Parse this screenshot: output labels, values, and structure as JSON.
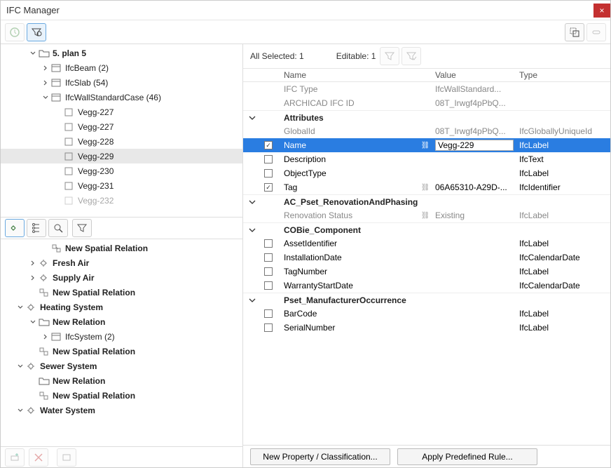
{
  "title": "IFC Manager",
  "close_label": "×",
  "selection": {
    "all_selected": "All Selected: 1",
    "editable": "Editable: 1"
  },
  "headers": {
    "name": "Name",
    "value": "Value",
    "type": "Type"
  },
  "cols": {
    "ifc_type": {
      "name": "IFC Type",
      "value": "IfcWallStandard..."
    },
    "archicad_id": {
      "name": "ARCHICAD IFC ID",
      "value": "08T_Irwgf4pPbQ..."
    }
  },
  "groups": {
    "attributes": "Attributes",
    "renov": "AC_Pset_RenovationAndPhasing",
    "cobie": "COBie_Component",
    "pset_mfr": "Pset_ManufacturerOccurrence"
  },
  "attrs": {
    "globalid": {
      "name": "GlobalId",
      "value": "08T_Irwgf4pPbQ...",
      "type": "IfcGloballyUniqueId"
    },
    "name": {
      "name": "Name",
      "value": "Vegg-229",
      "type": "IfcLabel"
    },
    "desc": {
      "name": "Description",
      "type": "IfcText"
    },
    "objtype": {
      "name": "ObjectType",
      "type": "IfcLabel"
    },
    "tag": {
      "name": "Tag",
      "value": "06A65310-A29D-...",
      "type": "IfcIdentifier"
    }
  },
  "renov": {
    "status": {
      "name": "Renovation Status",
      "value": "Existing",
      "type": "IfcLabel"
    }
  },
  "cobie": {
    "assetid": {
      "name": "AssetIdentifier",
      "type": "IfcLabel"
    },
    "instdate": {
      "name": "InstallationDate",
      "type": "IfcCalendarDate"
    },
    "tagno": {
      "name": "TagNumber",
      "type": "IfcLabel"
    },
    "warranty": {
      "name": "WarrantyStartDate",
      "type": "IfcCalendarDate"
    }
  },
  "mfr": {
    "barcode": {
      "name": "BarCode",
      "type": "IfcLabel"
    },
    "serial": {
      "name": "SerialNumber",
      "type": "IfcLabel"
    }
  },
  "tree1": {
    "plan5": "5. plan 5",
    "beam": "IfcBeam (2)",
    "slab": "IfcSlab (54)",
    "wall": "IfcWallStandardCase (46)",
    "v227a": "Vegg-227",
    "v227b": "Vegg-227",
    "v228": "Vegg-228",
    "v229": "Vegg-229",
    "v230": "Vegg-230",
    "v231": "Vegg-231",
    "v232": "Vegg-232"
  },
  "tree2": {
    "nsr1": "New Spatial Relation",
    "fresh": "Fresh Air",
    "supply": "Supply Air",
    "nsr2": "New Spatial Relation",
    "heat": "Heating System",
    "newrel": "New Relation",
    "ifcsys": "IfcSystem (2)",
    "nsr3": "New Spatial Relation",
    "sewer": "Sewer System",
    "newrel2": "New Relation",
    "nsr4": "New Spatial Relation",
    "water": "Water System"
  },
  "footer": {
    "new_prop": "New Property / Classification...",
    "apply_rule": "Apply Predefined Rule..."
  }
}
